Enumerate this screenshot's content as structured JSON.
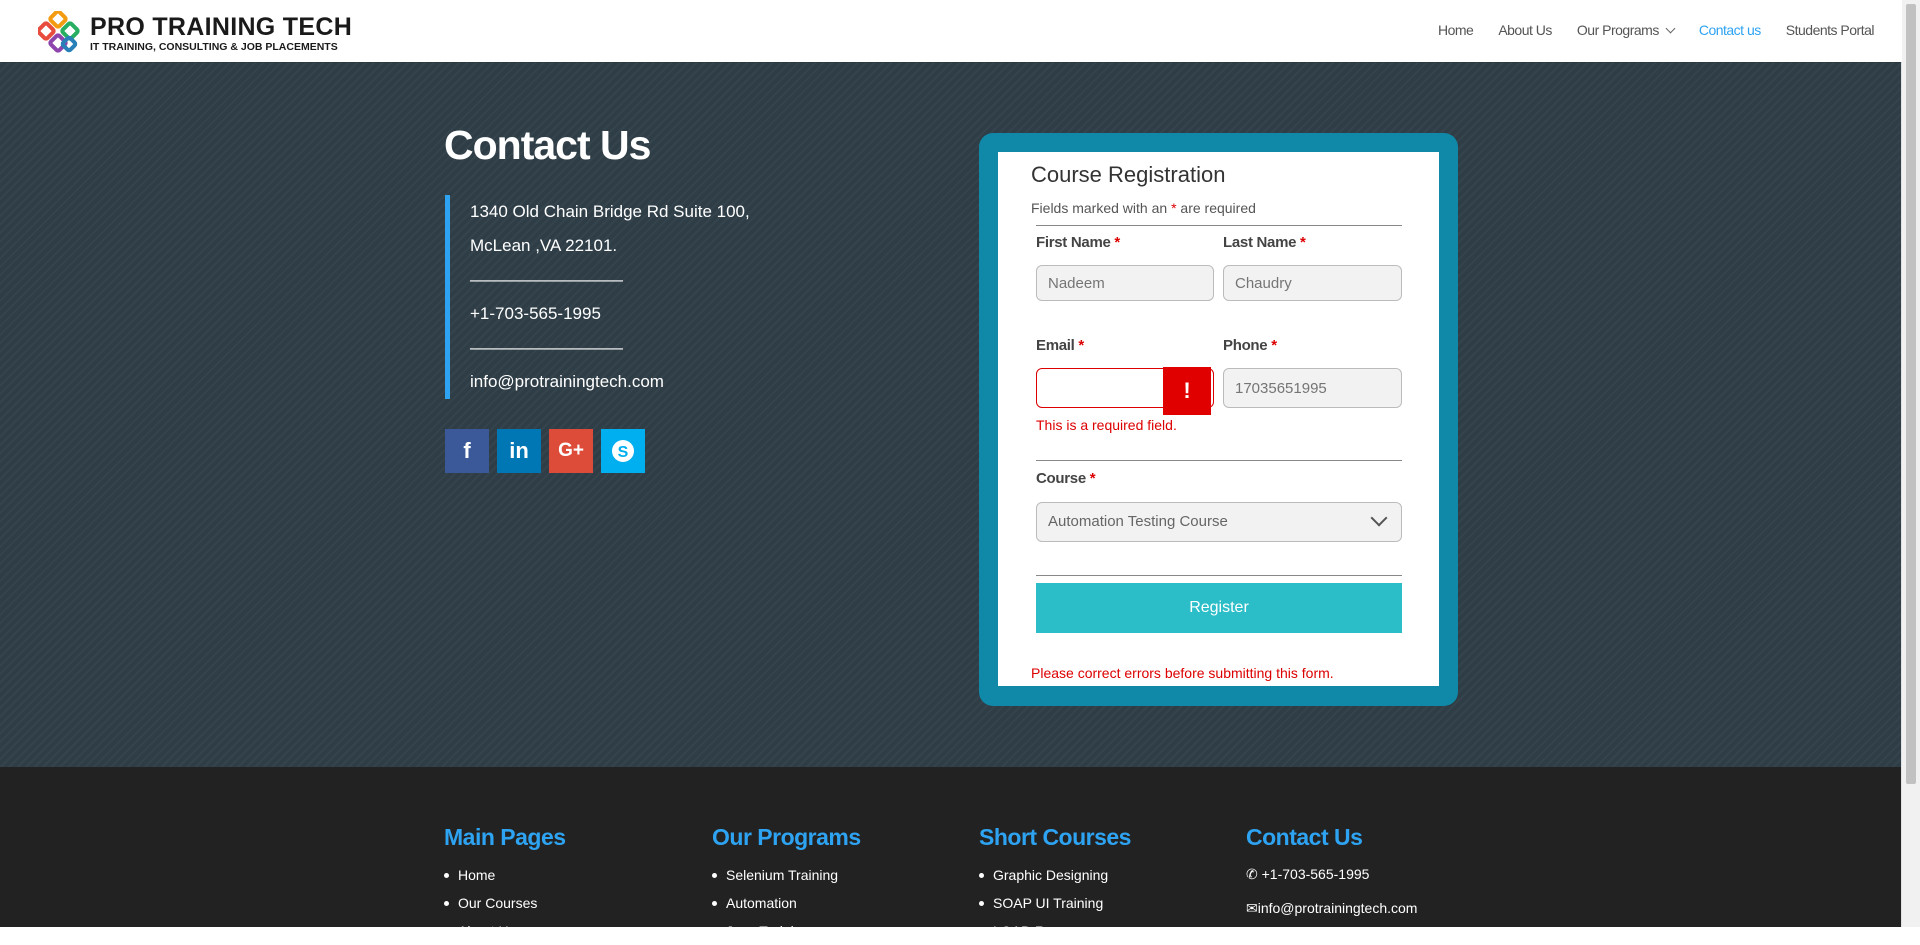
{
  "header": {
    "logo_name": "PRO TRAINING TECH",
    "logo_tagline": "IT TRAINING, CONSULTING & JOB PLACEMENTS",
    "nav": [
      {
        "label": "Home"
      },
      {
        "label": "About Us"
      },
      {
        "label": "Our Programs"
      },
      {
        "label": "Contact us"
      },
      {
        "label": "Students Portal"
      }
    ]
  },
  "contact": {
    "title": "Contact Us",
    "address_line1": "1340 Old Chain Bridge Rd Suite 100,",
    "address_line2": "McLean ,VA  22101.",
    "divider": "—————————",
    "phone": "+1-703-565-1995",
    "email": "info@protrainingtech.com",
    "socials": [
      {
        "icon": "facebook-icon",
        "glyph": "f",
        "color": "#3b5998"
      },
      {
        "icon": "linkedin-icon",
        "glyph": "in",
        "color": "#0077b5"
      },
      {
        "icon": "google-plus-icon",
        "glyph": "G+",
        "color": "#dd4b39"
      },
      {
        "icon": "skype-icon",
        "glyph": "S",
        "color": "#00aff0"
      }
    ]
  },
  "form": {
    "title": "Course Registration",
    "note_prefix": "Fields marked with an",
    "note_star": "*",
    "note_suffix": "are required",
    "first_name_label": "First Name",
    "first_name_placeholder": "Nadeem",
    "last_name_label": "Last Name",
    "last_name_placeholder": "Chaudry",
    "email_label": "Email",
    "email_value": "",
    "email_error_flag": "!",
    "email_error": "This is a required field.",
    "phone_label": "Phone",
    "phone_placeholder": "17035651995",
    "course_label": "Course",
    "course_selected": "Automation Testing Course",
    "required_star": "*",
    "submit_label": "Register",
    "form_error": "Please correct errors before submitting this form."
  },
  "footer": {
    "main_pages": {
      "title": "Main Pages",
      "items": [
        "Home",
        "Our Courses",
        "About Us"
      ]
    },
    "programs": {
      "title": "Our Programs",
      "items": [
        "Selenium Training",
        "Automation",
        "Java Training"
      ]
    },
    "short_courses": {
      "title": "Short Courses",
      "items": [
        "Graphic Designing",
        "SOAP UI Training",
        "LOAD Runner"
      ]
    },
    "contact": {
      "title": "Contact Us",
      "phone": "+1-703-565-1995",
      "email": "info@protrainingtech.com"
    }
  },
  "colors": {
    "accent": "#2ea3f2",
    "form_frame": "#1088a8",
    "button": "#2bbec8",
    "error": "#dd0000"
  }
}
